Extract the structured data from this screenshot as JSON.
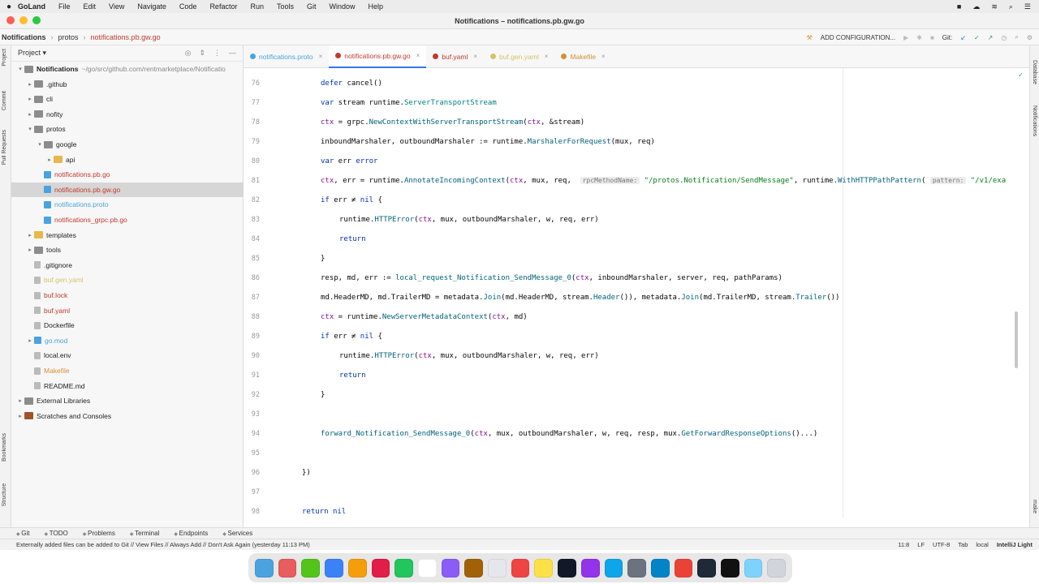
{
  "menubar": {
    "app": "GoLand",
    "items": [
      "File",
      "Edit",
      "View",
      "Navigate",
      "Code",
      "Refactor",
      "Run",
      "Tools",
      "Git",
      "Window",
      "Help"
    ]
  },
  "window": {
    "title": "Notifications – notifications.pb.gw.go"
  },
  "navbar": {
    "project": "Notifications",
    "folder": "protos",
    "file": "notifications.pb.gw.go",
    "add_config": "ADD CONFIGURATION...",
    "git": "Git:"
  },
  "left_strip": [
    "Project",
    "Commit",
    "Pull Requests",
    "Bookmarks",
    "Structure"
  ],
  "right_strip": [
    "Database",
    "Notifications",
    "make"
  ],
  "project_panel": {
    "title": "Project",
    "tree": [
      {
        "label": "Notifications",
        "extra": "~/go/src/github.com/rentmarketplace/Notificatio",
        "indent": 0,
        "arrow": "▾",
        "icon": "folder",
        "bold": true
      },
      {
        "label": ".github",
        "indent": 1,
        "arrow": "▸",
        "icon": "folder"
      },
      {
        "label": "cli",
        "indent": 1,
        "arrow": "▸",
        "icon": "folder"
      },
      {
        "label": "nofity",
        "indent": 1,
        "arrow": "▸",
        "icon": "folder"
      },
      {
        "label": "protos",
        "indent": 1,
        "arrow": "▾",
        "icon": "folder"
      },
      {
        "label": "google",
        "indent": 2,
        "arrow": "▾",
        "icon": "folder"
      },
      {
        "label": "api",
        "indent": 3,
        "arrow": "▸",
        "icon": "folder-yellow"
      },
      {
        "label": "notifications.pb.go",
        "indent": 2,
        "arrow": "",
        "icon": "go",
        "color": "#c0392b"
      },
      {
        "label": "notifications.pb.gw.go",
        "indent": 2,
        "arrow": "",
        "icon": "go",
        "color": "#c0392b",
        "selected": true
      },
      {
        "label": "notifications.proto",
        "indent": 2,
        "arrow": "",
        "icon": "go",
        "color": "#4aa3df"
      },
      {
        "label": "notifications_grpc.pb.go",
        "indent": 2,
        "arrow": "",
        "icon": "go",
        "color": "#c0392b"
      },
      {
        "label": "templates",
        "indent": 1,
        "arrow": "▸",
        "icon": "folder-yellow"
      },
      {
        "label": "tools",
        "indent": 1,
        "arrow": "▸",
        "icon": "folder"
      },
      {
        "label": ".gitignore",
        "indent": 1,
        "arrow": "",
        "icon": "file"
      },
      {
        "label": "buf.gen.yaml",
        "indent": 1,
        "arrow": "",
        "icon": "file",
        "color": "#d4c36a"
      },
      {
        "label": "buf.lock",
        "indent": 1,
        "arrow": "",
        "icon": "file",
        "color": "#c0392b"
      },
      {
        "label": "buf.yaml",
        "indent": 1,
        "arrow": "",
        "icon": "file",
        "color": "#c0392b"
      },
      {
        "label": "Dockerfile",
        "indent": 1,
        "arrow": "",
        "icon": "file"
      },
      {
        "label": "go.mod",
        "indent": 1,
        "arrow": "▸",
        "icon": "go",
        "color": "#4aa3df"
      },
      {
        "label": "local.env",
        "indent": 1,
        "arrow": "",
        "icon": "file"
      },
      {
        "label": "Makefile",
        "indent": 1,
        "arrow": "",
        "icon": "file",
        "color": "#d4903a"
      },
      {
        "label": "README.md",
        "indent": 1,
        "arrow": "",
        "icon": "file"
      },
      {
        "label": "External Libraries",
        "indent": 0,
        "arrow": "▸",
        "icon": "folder"
      },
      {
        "label": "Scratches and Consoles",
        "indent": 0,
        "arrow": "▸",
        "icon": "folder-brown"
      }
    ]
  },
  "tabs": [
    {
      "label": "notifications.proto",
      "color": "#4aa3df"
    },
    {
      "label": "notifications.pb.gw.go",
      "color": "#c0392b",
      "active": true
    },
    {
      "label": "buf.yaml",
      "color": "#c0392b"
    },
    {
      "label": "buf.gen.yaml",
      "color": "#d4c36a"
    },
    {
      "label": "Makefile",
      "color": "#d4903a"
    }
  ],
  "code": [
    {
      "n": "76",
      "indent": 2,
      "html": "<span class='kw'>defer</span> cancel()"
    },
    {
      "n": "77",
      "indent": 2,
      "html": "<span class='kw'>var</span> stream runtime.<span class='ty'>ServerTransportStream</span>"
    },
    {
      "n": "78",
      "indent": 2,
      "html": "<span class='var'>ctx</span> = grpc.<span class='fn'>NewContextWithServerTransportStream</span>(<span class='var'>ctx</span>, &amp;stream)"
    },
    {
      "n": "79",
      "indent": 2,
      "html": "inboundMarshaler, outboundMarshaler := runtime.<span class='fn'>MarshalerForRequest</span>(mux, req)"
    },
    {
      "n": "80",
      "indent": 2,
      "html": "<span class='kw'>var</span> err <span class='kw'>error</span>"
    },
    {
      "n": "81",
      "indent": 2,
      "html": "<span class='var'>ctx</span>, err = runtime.<span class='fn'>AnnotateIncomingContext</span>(<span class='var'>ctx</span>, mux, req,  <span class='hint'>rpcMethodName:</span> <span class='str'>\"/protos.Notification/SendMessage\"</span>, runtime.<span class='fn'>WithHTTPPathPattern</span>( <span class='hint'>pattern:</span> <span class='str'>\"/v1/exa</span>"
    },
    {
      "n": "82",
      "indent": 2,
      "html": "<span class='kw'>if</span> err ≠ <span class='kw'>nil</span> {"
    },
    {
      "n": "83",
      "indent": 3,
      "html": "runtime.<span class='fn'>HTTPError</span>(<span class='var'>ctx</span>, mux, outboundMarshaler, w, req, err)"
    },
    {
      "n": "84",
      "indent": 3,
      "html": "<span class='kw'>return</span>"
    },
    {
      "n": "85",
      "indent": 2,
      "html": "}"
    },
    {
      "n": "86",
      "indent": 2,
      "html": "resp, md, err := <span class='fn'>local_request_Notification_SendMessage_0</span>(<span class='var'>ctx</span>, inboundMarshaler, server, req, pathParams)"
    },
    {
      "n": "87",
      "indent": 2,
      "html": "md.HeaderMD, md.TrailerMD = metadata.<span class='fn'>Join</span>(md.HeaderMD, stream.<span class='fn'>Header</span>()), metadata.<span class='fn'>Join</span>(md.TrailerMD, stream.<span class='fn'>Trailer</span>())"
    },
    {
      "n": "88",
      "indent": 2,
      "html": "<span class='var'>ctx</span> = runtime.<span class='fn'>NewServerMetadataContext</span>(<span class='var'>ctx</span>, md)"
    },
    {
      "n": "89",
      "indent": 2,
      "html": "<span class='kw'>if</span> err ≠ <span class='kw'>nil</span> {"
    },
    {
      "n": "90",
      "indent": 3,
      "html": "runtime.<span class='fn'>HTTPError</span>(<span class='var'>ctx</span>, mux, outboundMarshaler, w, req, err)"
    },
    {
      "n": "91",
      "indent": 3,
      "html": "<span class='kw'>return</span>"
    },
    {
      "n": "92",
      "indent": 2,
      "html": "}"
    },
    {
      "n": "93",
      "indent": 2,
      "html": ""
    },
    {
      "n": "94",
      "indent": 2,
      "html": "<span class='fn'>forward_Notification_SendMessage_0</span>(<span class='var'>ctx</span>, mux, outboundMarshaler, w, req, resp, mux.<span class='fn'>GetForwardResponseOptions</span>()...)"
    },
    {
      "n": "95",
      "indent": 2,
      "html": ""
    },
    {
      "n": "96",
      "indent": 1,
      "html": "})"
    },
    {
      "n": "97",
      "indent": 1,
      "html": ""
    },
    {
      "n": "98",
      "indent": 1,
      "html": "<span class='kw'>return</span> <span class='kw'>nil</span>"
    }
  ],
  "bottom_tools": [
    "Git",
    "TODO",
    "Problems",
    "Terminal",
    "Endpoints",
    "Services"
  ],
  "status": {
    "message": "Externally added files can be added to Git // View Files // Always Add // Don't Ask Again (yesterday 11:13 PM)",
    "position": "11:8",
    "line_sep": "LF",
    "encoding": "UTF-8",
    "indent": "Tab",
    "vcs": "local",
    "theme": "IntelliJ Light"
  },
  "dock_colors": [
    "#4aa3df",
    "#e85d5d",
    "#52c41a",
    "#3b82f6",
    "#f59e0b",
    "#e11d48",
    "#22c55e",
    "#ffffff",
    "#8b5cf6",
    "#a16207",
    "#e5e7eb",
    "#ef4444",
    "#fde047",
    "#111827",
    "#9333ea",
    "#0ea5e9",
    "#6b7280",
    "#0284c7",
    "#ea4335",
    "#1f2937",
    "#111111",
    "#7dd3fc",
    "#d1d5db"
  ]
}
